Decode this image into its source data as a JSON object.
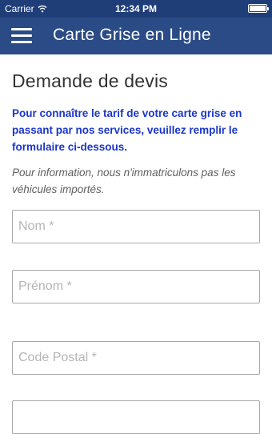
{
  "status_bar": {
    "carrier": "Carrier",
    "time": "12:34 PM",
    "battery_level": 1.0
  },
  "nav": {
    "title": "Carte Grise en Ligne",
    "menu_icon": "hamburger-menu-icon"
  },
  "page": {
    "heading": "Demande de devis",
    "intro": "Pour connaître le tarif de votre carte grise en passant par nos services, veuillez remplir le formulaire ci-dessous.",
    "note": "Pour information, nous n'immatriculons pas les véhicules importés."
  },
  "form": {
    "nom_placeholder": "Nom *",
    "prenom_placeholder": "Prénom *",
    "code_postal_placeholder": "Code Postal *",
    "next_placeholder": ""
  },
  "colors": {
    "navbar": "#2a4b85",
    "statusbar": "#1f3e78",
    "intro_text": "#1b36c9"
  }
}
